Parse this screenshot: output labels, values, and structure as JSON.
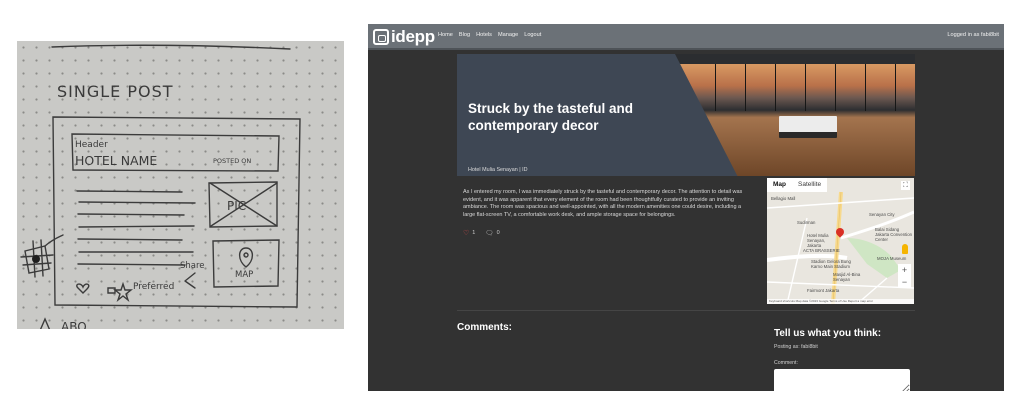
{
  "sketch": {
    "heading": "SINGLE POST",
    "header_label": "Header",
    "hotel_name": "HOTEL NAME",
    "posted_on": "POSTED ON",
    "pic_label": "PIC",
    "map_label": "MAP",
    "share_label": "Share",
    "preferred_label": "Preferred",
    "bottom_fragment": "ABO"
  },
  "nav": {
    "logo": "idepp",
    "links": [
      "Home",
      "Blog",
      "Hotels",
      "Manage",
      "Logout"
    ],
    "login_status": "Logged in as fabi8bit"
  },
  "hero": {
    "title": "Struck by the tasteful and contemporary decor",
    "subtitle": "Hotel Mulia Senayan | ID"
  },
  "post": {
    "body": "As I entered my room, I was immediately struck by the tasteful and contemporary decor. The attention to detail was evident, and it was apparent that every element of the room had been thoughtfully curated to provide an inviting ambiance. The room was spacious and well-appointed, with all the modern amenities one could desire, including a large flat-screen TV, a comfortable work desk, and ample storage space for belongings.",
    "likes": "1",
    "comments_count": "0"
  },
  "map": {
    "tabs": [
      "Map",
      "Satellite"
    ],
    "labels": [
      "Bellagio Mall",
      "Sudirman",
      "Senayan City",
      "Balai Sidang Jakarta Convention Center",
      "Hotel Mulia Senayan, Jakarta",
      "ACTA BRASSERIE",
      "Stadion Gelora Bung Karno Main Stadium",
      "Masjid Al-Bina Senayan",
      "MOJA Museum",
      "Fairmont Jakarta"
    ],
    "footer": "Keyboard shortcuts   Map data ©2023 Google   Terms of Use   Report a map error"
  },
  "comments": {
    "title": "Comments:",
    "form_title": "Tell us what you think:",
    "posting_as": "Posting as: fabi8bit",
    "comment_label": "Comment:"
  }
}
